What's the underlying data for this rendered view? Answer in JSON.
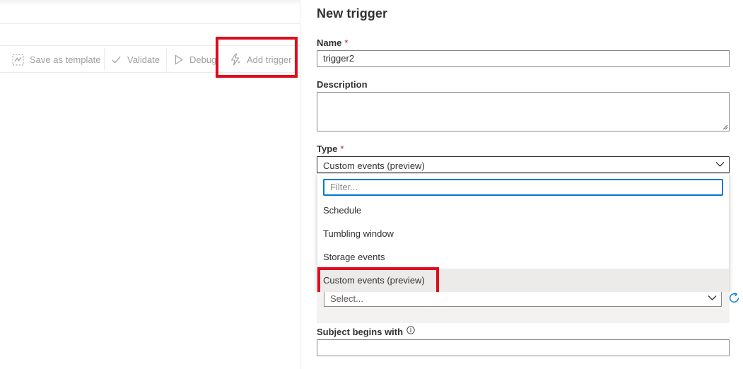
{
  "toolbar": {
    "save_as_template": "Save as template",
    "validate": "Validate",
    "debug": "Debug",
    "add_trigger": "Add trigger"
  },
  "panel": {
    "title": "New trigger",
    "name_label": "Name",
    "name_value": "trigger2",
    "description_label": "Description",
    "description_value": "",
    "type_label": "Type",
    "type_value": "Custom events (preview)",
    "required_marker": "*",
    "type_options": [
      "Schedule",
      "Tumbling window",
      "Storage events",
      "Custom events (preview)"
    ],
    "selected_option": "Custom events (preview)",
    "filter_placeholder": "Filter...",
    "event_topic_placeholder": "Select...",
    "subject_begins_label": "Subject begins with",
    "subject_begins_value": ""
  },
  "colors": {
    "highlight_border": "#e00b1c",
    "focus_border": "#0078d4",
    "required": "#a4262c",
    "disabled_text": "#a19f9d"
  },
  "icons": {
    "save_as_template": "template-icon",
    "validate": "checkmark-icon",
    "debug": "play-icon",
    "add_trigger": "lightning-icon",
    "type_dropdown": "chevron-down-icon",
    "refresh": "refresh-icon",
    "info": "info-icon"
  }
}
